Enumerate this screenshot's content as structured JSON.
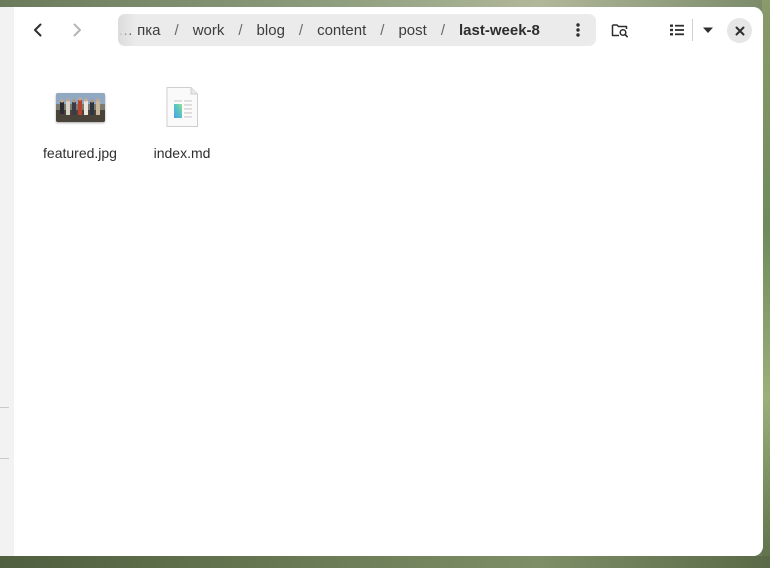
{
  "window": {
    "nav": {
      "back_icon": "go-previous-icon",
      "forward_icon": "go-next-icon"
    },
    "pathbar": {
      "crumbs": [
        {
          "label": "… пка",
          "truncated": true
        },
        {
          "label": "work"
        },
        {
          "label": "blog"
        },
        {
          "label": "content"
        },
        {
          "label": "post"
        },
        {
          "label": "last-week-8",
          "current": true
        }
      ],
      "separator": "/",
      "menu_icon": "view-more-icon"
    },
    "toolbar": {
      "search_icon": "folder-search-icon",
      "view_icon": "list-view-icon",
      "view_menu_icon": "pan-down-icon",
      "close_icon": "window-close-icon"
    }
  },
  "files": [
    {
      "name": "featured.jpg",
      "kind": "image",
      "icon": "image-thumbnail"
    },
    {
      "name": "index.md",
      "kind": "text",
      "icon": "text-x-generic-icon"
    }
  ],
  "colors": {
    "window_bg": "#ffffff",
    "pathbar_bg": "#ebebeb",
    "text": "#2e2e2e",
    "close_bg": "#e6e6e6"
  }
}
